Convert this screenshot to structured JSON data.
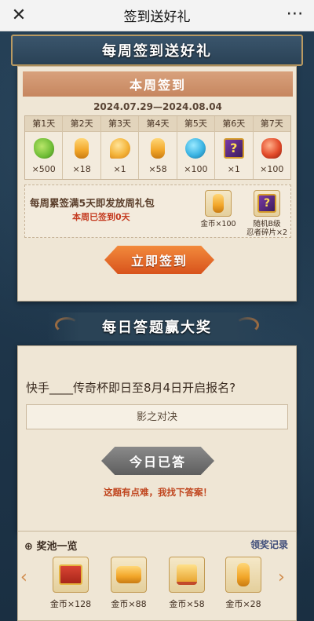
{
  "nav": {
    "title": "签到送好礼",
    "close_icon": "close-icon",
    "more_icon": "more-icon"
  },
  "weekly": {
    "banner": "每周签到送好礼",
    "header": "本周签到",
    "date_range": "2024.07.29—2024.08.04",
    "days": [
      {
        "label": "第1天",
        "qty": "×500",
        "icon": "shoe-icon"
      },
      {
        "label": "第2天",
        "qty": "×18",
        "icon": "gold-bar-icon"
      },
      {
        "label": "第3天",
        "qty": "×1",
        "icon": "bubble-icon"
      },
      {
        "label": "第4天",
        "qty": "×58",
        "icon": "gold-bar-icon"
      },
      {
        "label": "第5天",
        "qty": "×100",
        "icon": "blue-orb-icon"
      },
      {
        "label": "第6天",
        "qty": "×1",
        "icon": "mystery-box-icon"
      },
      {
        "label": "第7天",
        "qty": "×100",
        "icon": "red-gem-icon"
      }
    ],
    "bonus_title": "每周累签满5天即发放周礼包",
    "bonus_sub": "本周已签到0天",
    "bonus_items": [
      {
        "label": "金币×100",
        "icon": "gold-bar-icon"
      },
      {
        "label_line1": "随机B级",
        "label_line2": "忍者碎片×2",
        "icon": "mystery-box-icon"
      }
    ],
    "checkin_button": "立即签到"
  },
  "daily": {
    "banner": "每日答题赢大奖",
    "question": "快手____传奇杯即日至8月4日开启报名?",
    "answer": "影之对决",
    "answered_button": "今日已答",
    "hint": "这题有点难，我找下答案！"
  },
  "prizes": {
    "title": "奖池一览",
    "record_link": "领奖记录",
    "items": [
      {
        "label": "金币×128",
        "icon": "treasure-chest-icon"
      },
      {
        "label": "金币×88",
        "icon": "gold-pile-icon"
      },
      {
        "label": "金币×58",
        "icon": "gold-bundle-icon"
      },
      {
        "label": "金币×28",
        "icon": "gold-bar-icon"
      }
    ]
  },
  "colors": {
    "accent_orange": "#d8531c",
    "banner_blue": "#2a4356",
    "paper": "#efe6d5",
    "hint_red": "#c0461f"
  }
}
